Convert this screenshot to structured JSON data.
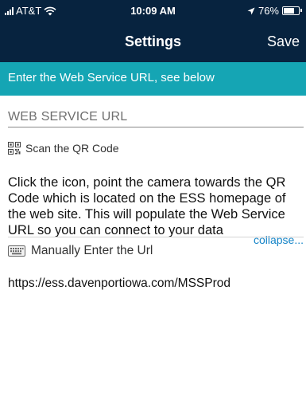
{
  "status_bar": {
    "carrier": "AT&T",
    "time": "10:09 AM",
    "battery": "76%",
    "battery_level": 0.76
  },
  "nav": {
    "title": "Settings",
    "save_label": "Save"
  },
  "banner": {
    "text": "Enter the Web Service URL, see below"
  },
  "url_field": {
    "placeholder": "WEB SERVICE URL",
    "value": ""
  },
  "qr_section": {
    "icon": "qr-code-icon",
    "label": "Scan the QR Code",
    "description": "Click the icon, point the camera towards the QR Code which is located on the ESS homepage of the web site. This will populate the Web Service URL so you can connect to your data",
    "collapse_label": "collapse..."
  },
  "manual_section": {
    "icon": "keyboard-icon",
    "label": "Manually Enter the Url",
    "url": "https://ess.davenportiowa.com/MSSProd"
  },
  "colors": {
    "header_bg": "#07233f",
    "banner_bg": "#15a5b4",
    "link": "#1584c7"
  }
}
